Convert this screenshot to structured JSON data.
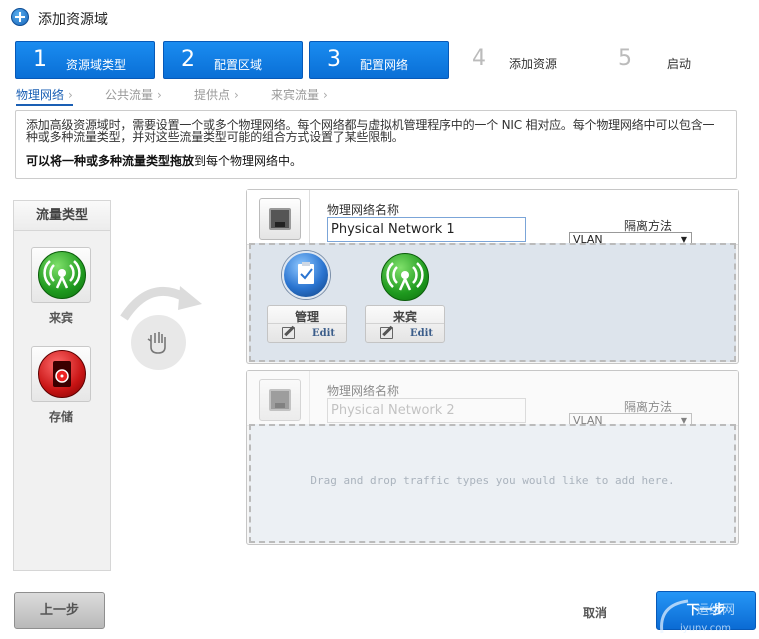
{
  "title": "添加资源域",
  "steps": [
    {
      "num": "1",
      "label": "资源域类型",
      "active": true
    },
    {
      "num": "2",
      "label": "配置区域",
      "active": true
    },
    {
      "num": "3",
      "label": "配置网络",
      "active": true
    },
    {
      "num": "4",
      "label": "添加资源",
      "active": false
    },
    {
      "num": "5",
      "label": "启动",
      "active": false
    }
  ],
  "tabs": [
    {
      "label": "物理网络",
      "arrow": "›"
    },
    {
      "label": "公共流量",
      "arrow": "›"
    },
    {
      "label": "提供点",
      "arrow": "›"
    },
    {
      "label": "来宾流量",
      "arrow": "›"
    }
  ],
  "info": {
    "description": "添加高级资源域时，需要设置一个或多个物理网络。每个网络都与虚拟机管理程序中的一个 NIC 相对应。每个物理网络中可以包含一种或多种流量类型，并对这些流量类型可能的组合方式设置了某些限制。",
    "drag_hint_bold": "可以将一种或多种流量类型拖放",
    "drag_hint_rest": "到每个物理网络中。"
  },
  "traffic_panel": {
    "title": "流量类型",
    "items": [
      {
        "label": "来宾",
        "icon": "guest-traffic-icon"
      },
      {
        "label": "存储",
        "icon": "storage-traffic-icon"
      }
    ]
  },
  "networks": [
    {
      "name_label": "物理网络名称",
      "name_value": "Physical Network 1",
      "isolation_label": "隔离方法",
      "isolation_value": "VLAN",
      "assigned": [
        {
          "label": "管理",
          "edit": "Edit",
          "icon": "management-traffic-icon"
        },
        {
          "label": "来宾",
          "edit": "Edit",
          "icon": "guest-traffic-icon"
        }
      ]
    },
    {
      "name_label": "物理网络名称",
      "name_value": "Physical Network 2",
      "isolation_label": "隔离方法",
      "isolation_value": "VLAN",
      "drop_hint": "Drag and drop traffic types you would like to add here."
    }
  ],
  "buttons": {
    "back": "上一步",
    "cancel": "取消",
    "next": "下一步"
  },
  "watermark": {
    "line1": "运维网",
    "line2": "iyunv.com"
  },
  "colors": {
    "accent": "#0b6bd4",
    "guest": "#1f9a1f",
    "storage": "#c81414",
    "management": "#2a74d0"
  }
}
